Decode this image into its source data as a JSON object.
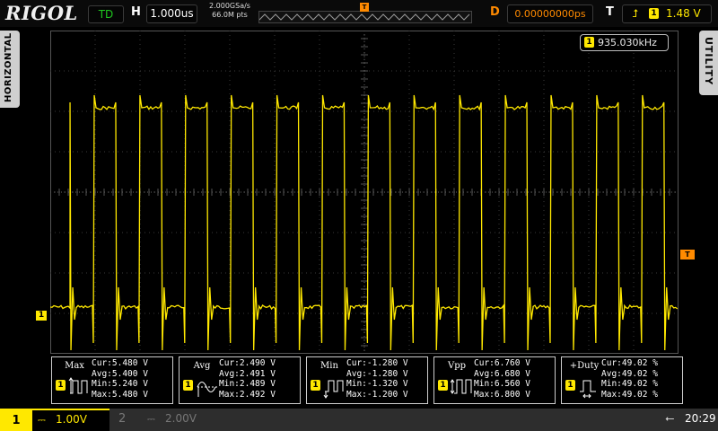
{
  "brand": "RIGOL",
  "status": {
    "run_state": "TD"
  },
  "horizontal": {
    "label": "H",
    "timebase": "1.000us",
    "sample_rate": "2.000GSa/s",
    "memory_depth": "66.0M pts"
  },
  "delay": {
    "label": "D",
    "value": "0.00000000ps"
  },
  "trigger": {
    "label": "T",
    "edge_icon": "rising-edge-icon",
    "source": "1",
    "level": "1.48 V"
  },
  "side_menus": {
    "left": "HORIZONTAL",
    "right": "UTILITY"
  },
  "frequency_counter": {
    "channel": "1",
    "value": "935.030kHz"
  },
  "markers": {
    "channel1": "1",
    "trigger_level": "T",
    "trigger_position": "T"
  },
  "measurements": [
    {
      "name": "Max",
      "channel": "1",
      "icon": "max-waveform-icon",
      "cur": "Cur:5.480 V",
      "avg": "Avg:5.400 V",
      "min": "Min:5.240 V",
      "max": "Max:5.480 V"
    },
    {
      "name": "Avg",
      "channel": "1",
      "icon": "avg-waveform-icon",
      "cur": "Cur:2.490 V",
      "avg": "Avg:2.491 V",
      "min": "Min:2.489 V",
      "max": "Max:2.492 V"
    },
    {
      "name": "Min",
      "channel": "1",
      "icon": "min-waveform-icon",
      "cur": "Cur:-1.280 V",
      "avg": "Avg:-1.280 V",
      "min": "Min:-1.320 V",
      "max": "Max:-1.200 V"
    },
    {
      "name": "Vpp",
      "channel": "1",
      "icon": "vpp-waveform-icon",
      "cur": "Cur:6.760 V",
      "avg": "Avg:6.680 V",
      "min": "Min:6.560 V",
      "max": "Max:6.800 V"
    },
    {
      "name": "+Duty",
      "channel": "1",
      "icon": "duty-waveform-icon",
      "cur": "Cur:49.02 %",
      "avg": "Avg:49.02 %",
      "min": "Min:49.02 %",
      "max": "Max:49.02 %"
    }
  ],
  "channels": [
    {
      "number": "1",
      "coupling_icon": "dc-coupling-icon",
      "scale": "1.00V",
      "active": true
    },
    {
      "number": "2",
      "coupling_icon": "dc-coupling-icon",
      "scale": "2.00V",
      "active": false
    }
  ],
  "system": {
    "usb_icon": "usb-icon",
    "time": "20:29"
  },
  "colors": {
    "ch1": "#ffe800",
    "trigger": "#ff8a00",
    "ch2_inactive": "#777777",
    "grid": "#3a3a3a"
  }
}
